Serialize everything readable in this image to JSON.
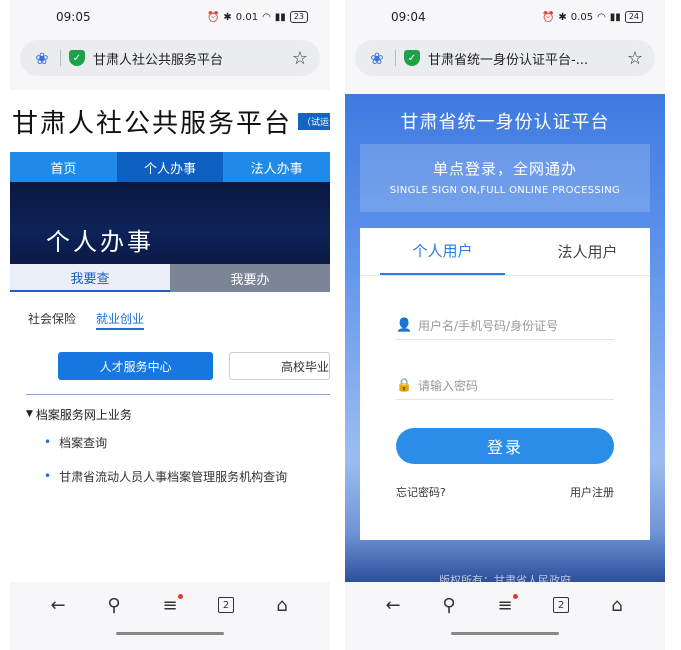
{
  "left": {
    "status": {
      "time": "09:05",
      "net": "0.01",
      "battery": "23"
    },
    "url": {
      "title": "甘肃人社公共服务平台"
    },
    "site": {
      "title": "甘肃人社公共服务平台",
      "badge": "（试运",
      "nav": [
        "首页",
        "个人办事",
        "法人办事"
      ],
      "banner": "个人办事",
      "subtabs": [
        "我要查",
        "我要办"
      ],
      "categories": [
        "社会保险",
        "就业创业"
      ],
      "buttons": [
        "人才服务中心",
        "高校毕业"
      ],
      "tree_head": "档案服务网上业务",
      "tree_items": [
        "档案查询",
        "甘肃省流动人员人事档案管理服务机构查询"
      ]
    },
    "bottom": {
      "tabs": "2"
    }
  },
  "right": {
    "status": {
      "time": "09:04",
      "net": "0.05",
      "battery": "24"
    },
    "url": {
      "title": "甘肃省统一身份认证平台-..."
    },
    "site": {
      "title": "甘肃省统一身份认证平台",
      "slogan_cn": "单点登录，全网通办",
      "slogan_en": "SINGLE SIGN ON,FULL ONLINE PROCESSING",
      "tabs": [
        "个人用户",
        "法人用户"
      ],
      "username_placeholder": "用户名/手机号码/身份证号",
      "password_placeholder": "请输入密码",
      "login": "登录",
      "forgot": "忘记密码?",
      "register": "用户注册",
      "footer": "版权所有：甘肃省人民政府"
    },
    "bottom": {
      "tabs": "2"
    }
  }
}
